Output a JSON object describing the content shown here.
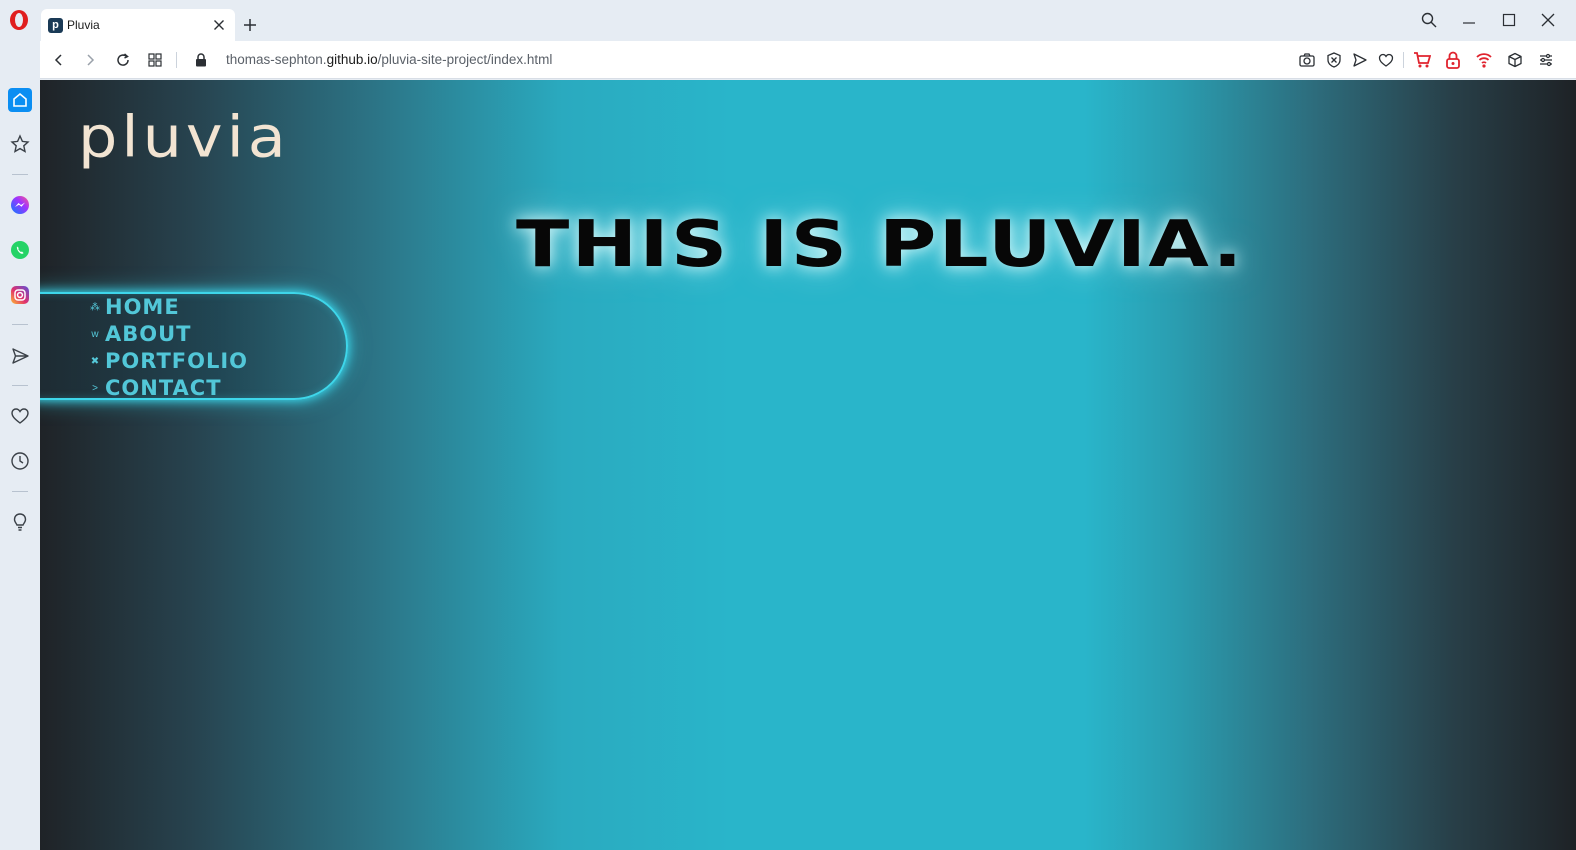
{
  "browser": {
    "tab": {
      "favicon_letter": "p",
      "title": "Pluvia"
    },
    "address": {
      "prefix": "thomas-sephton.",
      "host": "github.io",
      "path": "/pluvia-site-project/index.html"
    },
    "colors": {
      "sidebar_bg": "#e6ecf3",
      "accent": "#0b8ef2"
    },
    "sidebar_icons": [
      "opera-logo-icon",
      "home-icon",
      "star-icon",
      "messenger-icon",
      "whatsapp-icon",
      "instagram-icon",
      "send-icon",
      "heart-icon",
      "clock-icon",
      "lightbulb-icon"
    ],
    "toolbar_icons": [
      "back-icon",
      "forward-icon",
      "reload-icon",
      "tabs-grid-icon",
      "lock-icon",
      "camera-icon",
      "adblock-icon",
      "send-icon",
      "heart-icon",
      "cart-icon",
      "lock-extension-icon",
      "wifi-icon",
      "cube-icon",
      "menu-icon"
    ]
  },
  "page": {
    "brand": "pluvia",
    "headline": "THIS IS PLUVIA.",
    "nav": [
      {
        "bullet": "⁂",
        "label": "Home"
      },
      {
        "bullet": "w",
        "label": "About"
      },
      {
        "bullet": "✖",
        "label": "Portfolio"
      },
      {
        "bullet": ">",
        "label": "Contact"
      }
    ],
    "colors": {
      "background_center": "#29b5ca",
      "background_edge": "#1e2226",
      "nav_text": "#52c7d8",
      "nav_glow": "#3ed6ea",
      "brand_text": "#f2e4d2",
      "headline": "#070707"
    }
  }
}
